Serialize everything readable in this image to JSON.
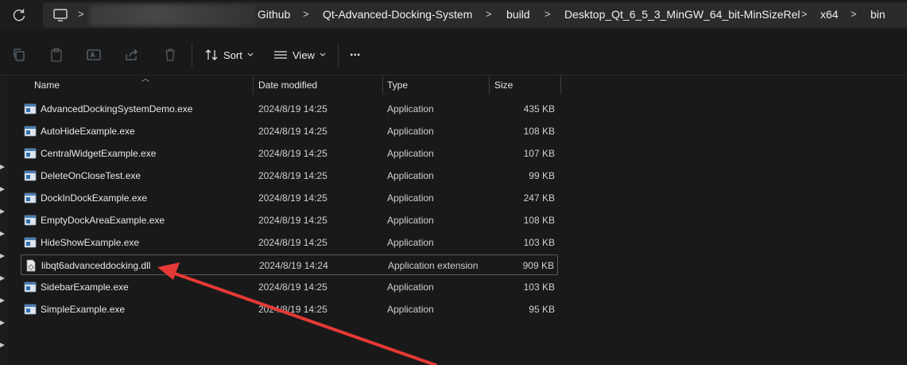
{
  "breadcrumb": {
    "items": [
      "Github",
      "Qt-Advanced-Docking-System",
      "build",
      "Desktop_Qt_6_5_3_MinGW_64_bit-MinSizeRel",
      "x64",
      "bin"
    ],
    "separator": ">"
  },
  "toolbar": {
    "sort_label": "Sort",
    "view_label": "View",
    "more_label": "..."
  },
  "columns": {
    "name": "Name",
    "date": "Date modified",
    "type": "Type",
    "size": "Size"
  },
  "files": [
    {
      "name": "AdvancedDockingSystemDemo.exe",
      "date": "2024/8/19 14:25",
      "type": "Application",
      "size": "435 KB",
      "icon": "exe-icon"
    },
    {
      "name": "AutoHideExample.exe",
      "date": "2024/8/19 14:25",
      "type": "Application",
      "size": "108 KB",
      "icon": "exe-icon"
    },
    {
      "name": "CentralWidgetExample.exe",
      "date": "2024/8/19 14:25",
      "type": "Application",
      "size": "107 KB",
      "icon": "exe-icon"
    },
    {
      "name": "DeleteOnCloseTest.exe",
      "date": "2024/8/19 14:25",
      "type": "Application",
      "size": "99 KB",
      "icon": "exe-icon"
    },
    {
      "name": "DockInDockExample.exe",
      "date": "2024/8/19 14:25",
      "type": "Application",
      "size": "247 KB",
      "icon": "exe-icon"
    },
    {
      "name": "EmptyDockAreaExample.exe",
      "date": "2024/8/19 14:25",
      "type": "Application",
      "size": "108 KB",
      "icon": "exe-icon"
    },
    {
      "name": "HideShowExample.exe",
      "date": "2024/8/19 14:25",
      "type": "Application",
      "size": "103 KB",
      "icon": "exe-icon"
    },
    {
      "name": "libqt6advanceddocking.dll",
      "date": "2024/8/19 14:24",
      "type": "Application extension",
      "size": "909 KB",
      "icon": "dll-icon"
    },
    {
      "name": "SidebarExample.exe",
      "date": "2024/8/19 14:25",
      "type": "Application",
      "size": "103 KB",
      "icon": "exe-icon"
    },
    {
      "name": "SimpleExample.exe",
      "date": "2024/8/19 14:25",
      "type": "Application",
      "size": "95 KB",
      "icon": "exe-icon"
    }
  ],
  "selected_index": 7,
  "colors": {
    "annotation_arrow": "#e53935",
    "background": "#191919"
  }
}
